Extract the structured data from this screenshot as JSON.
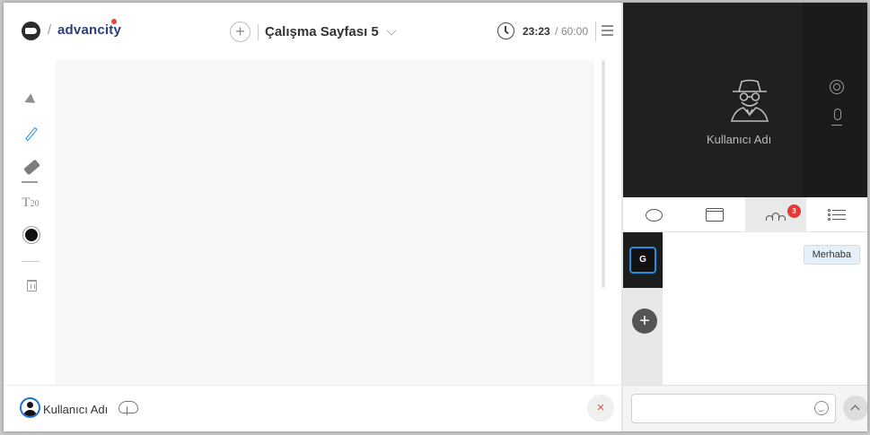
{
  "brand": {
    "separator": "/",
    "name": "advancity"
  },
  "page": {
    "add_symbol": "+",
    "title": "Çalışma Sayfası 5"
  },
  "timer": {
    "elapsed": "23:23",
    "separator": "/",
    "total": "60:00"
  },
  "tools": [
    {
      "icon": "select-arrow-icon"
    },
    {
      "icon": "pen-icon",
      "active": true
    },
    {
      "icon": "eraser-icon"
    },
    {
      "icon": "text-size-icon",
      "letter": "T",
      "size": "20"
    },
    {
      "icon": "color-dot-icon",
      "color": "#111111"
    },
    {
      "icon": "trash-icon"
    }
  ],
  "footer": {
    "user_name": "Kullanıcı Adı",
    "close_symbol": "×"
  },
  "video": {
    "participant_name": "Kullanıcı Adı"
  },
  "tabs": [
    {
      "icon": "chat-icon"
    },
    {
      "icon": "folder-icon"
    },
    {
      "icon": "participants-icon",
      "badge": "3",
      "active": true
    },
    {
      "icon": "list-icon"
    }
  ],
  "groups": [
    {
      "label": "G",
      "selected": true
    }
  ],
  "group_add_symbol": "+",
  "messages": [
    {
      "text": "Merhaba"
    }
  ],
  "chat_input": {
    "value": "",
    "placeholder": ""
  },
  "colors": {
    "brand": "#2c3e7c",
    "accent": "#1d8fe6",
    "badge": "#e53935",
    "close": "#e05555"
  }
}
